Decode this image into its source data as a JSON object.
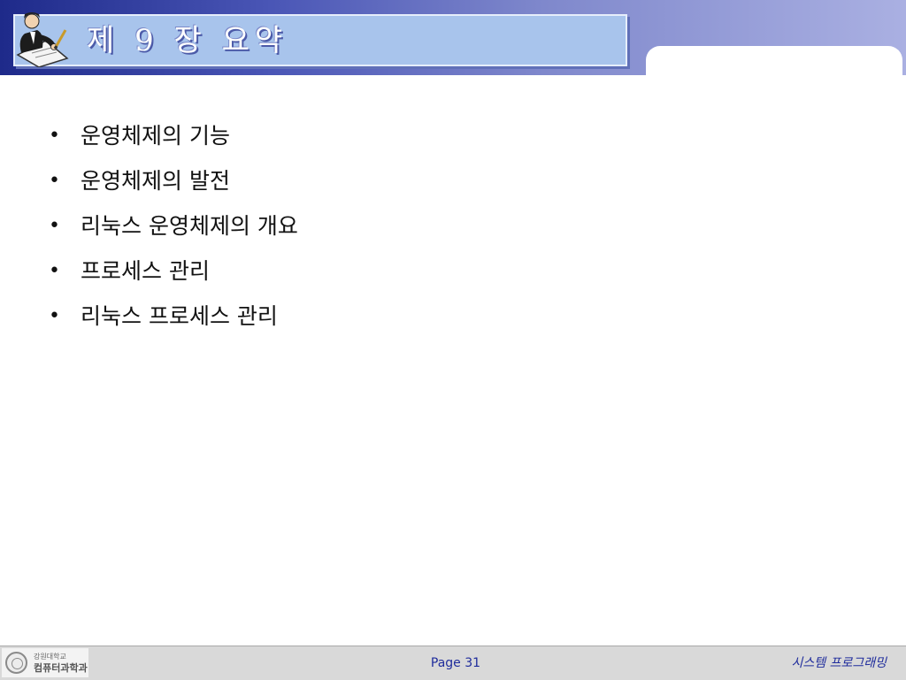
{
  "header": {
    "title": "제 9 장 요약",
    "icon": "writer-at-desk-icon"
  },
  "main": {
    "bullet_symbol": "•",
    "bullets": [
      "운영체제의 기능",
      "운영체제의 발전",
      "리눅스 운영체제의 개요",
      "프로세스 관리",
      "리눅스 프로세스 관리"
    ]
  },
  "footer": {
    "university": "강원대학교",
    "department": "컴퓨터과학과",
    "page": "Page 31",
    "course": "시스템 프로그래밍",
    "logo_icon": "university-seal-icon"
  },
  "colors": {
    "header_dark": "#1e2a8a",
    "title_box": "#a8c4ec",
    "footer_text": "#1f2c9c",
    "footer_bg": "#d9d9d9"
  }
}
